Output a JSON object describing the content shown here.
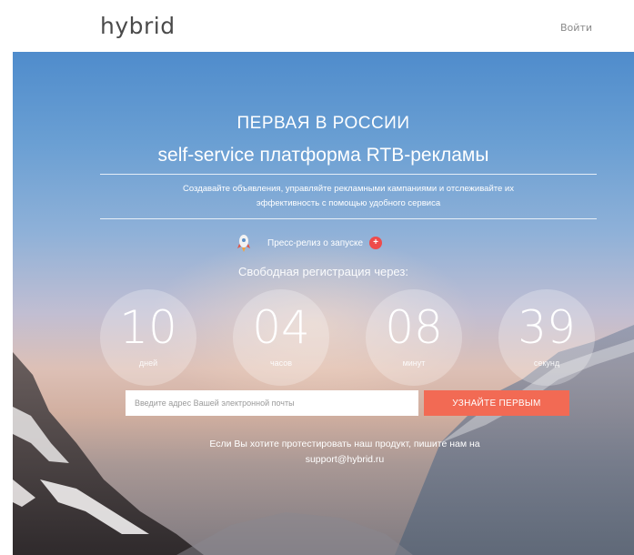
{
  "header": {
    "logo_text": "hybrid",
    "login_label": "Войти"
  },
  "hero": {
    "title_line1": "ПЕРВАЯ В РОССИИ",
    "title_line2": "self-service платформа RTB-рекламы",
    "subtitle_line1": "Создавайте объявления, управляйте рекламными кампаниями и отслеживайте их",
    "subtitle_line2": "эффективность с помощью удобного сервиса",
    "press_release_label": "Пресс-релиз о запуске",
    "press_badge": "+",
    "free_registration_label": "Свободная регистрация через:",
    "countdown": [
      {
        "value": "10",
        "unit": "дней"
      },
      {
        "value": "04",
        "unit": "часов"
      },
      {
        "value": "08",
        "unit": "минут"
      },
      {
        "value": "39",
        "unit": "секунд"
      }
    ],
    "email_placeholder": "Введите адрес Вашей электронной почты",
    "cta_label": "УЗНАЙТЕ ПЕРВЫМ",
    "support_line1": "Если Вы хотите протестировать наш продукт, пишите нам на",
    "support_line2": "support@hybrid.ru"
  },
  "colors": {
    "accent": "#f26a54",
    "badge": "#ee4b4b",
    "sky_top": "#4f8ccc"
  },
  "icons": {
    "rocket": "rocket-icon",
    "badge": "plus-badge-icon"
  }
}
